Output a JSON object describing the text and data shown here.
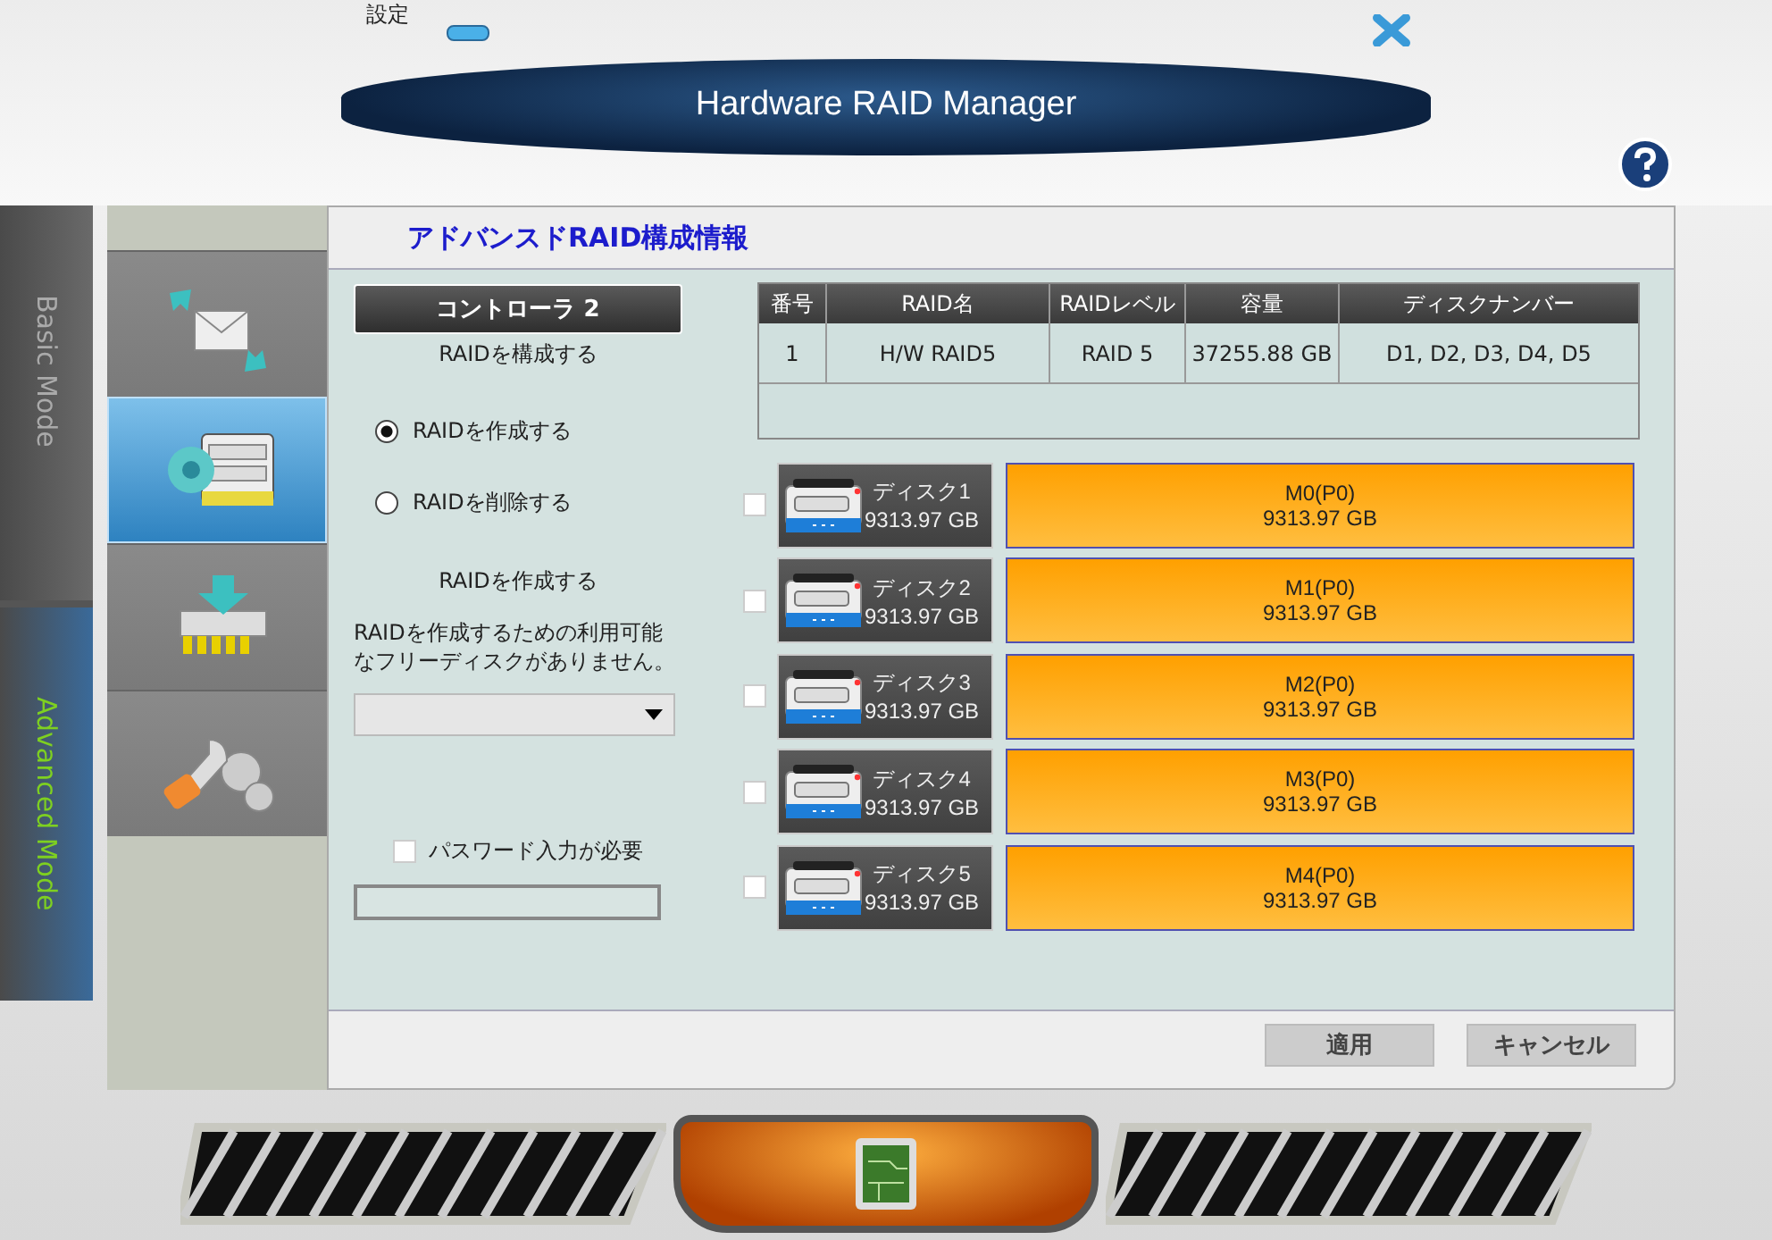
{
  "background_text": "設定",
  "window": {
    "title": "Hardware RAID Manager"
  },
  "modes": [
    {
      "label": "Basic Mode",
      "selected": false
    },
    {
      "label": "Advanced Mode",
      "selected": true
    }
  ],
  "nav_tabs": [
    {
      "kind": "mail",
      "selected": false
    },
    {
      "kind": "raid",
      "selected": true
    },
    {
      "kind": "memory",
      "selected": false
    },
    {
      "kind": "tools",
      "selected": false
    }
  ],
  "panel": {
    "title": "アドバンスドRAID構成情報"
  },
  "controller": {
    "label": "コントローラ 2",
    "subtitle": "RAIDを構成する"
  },
  "actions": [
    {
      "label": "RAIDを作成する",
      "selected": true
    },
    {
      "label": "RAIDを削除する",
      "selected": false
    }
  ],
  "create_section": {
    "heading": "RAIDを作成する",
    "message": "RAIDを作成するための利用可能なフリーディスクがありません。"
  },
  "password": {
    "label": "パスワード入力が必要",
    "checked": false
  },
  "table": {
    "columns": [
      "番号",
      "RAID名",
      "RAIDレベル",
      "容量",
      "ディスクナンバー"
    ],
    "rows": [
      [
        "1",
        "H/W RAID5",
        "RAID 5",
        "37255.88 GB",
        "D1, D2, D3, D4, D5"
      ]
    ]
  },
  "disks": [
    {
      "name": "ディスク1",
      "size": "9313.97 GB",
      "checked": false,
      "member": "M0(P0)",
      "member_size": "9313.97 GB"
    },
    {
      "name": "ディスク2",
      "size": "9313.97 GB",
      "checked": false,
      "member": "M1(P0)",
      "member_size": "9313.97 GB"
    },
    {
      "name": "ディスク3",
      "size": "9313.97 GB",
      "checked": false,
      "member": "M2(P0)",
      "member_size": "9313.97 GB"
    },
    {
      "name": "ディスク4",
      "size": "9313.97 GB",
      "checked": false,
      "member": "M3(P0)",
      "member_size": "9313.97 GB"
    },
    {
      "name": "ディスク5",
      "size": "9313.97 GB",
      "checked": false,
      "member": "M4(P0)",
      "member_size": "9313.97 GB"
    }
  ],
  "buttons": [
    "適用",
    "キャンセル"
  ]
}
